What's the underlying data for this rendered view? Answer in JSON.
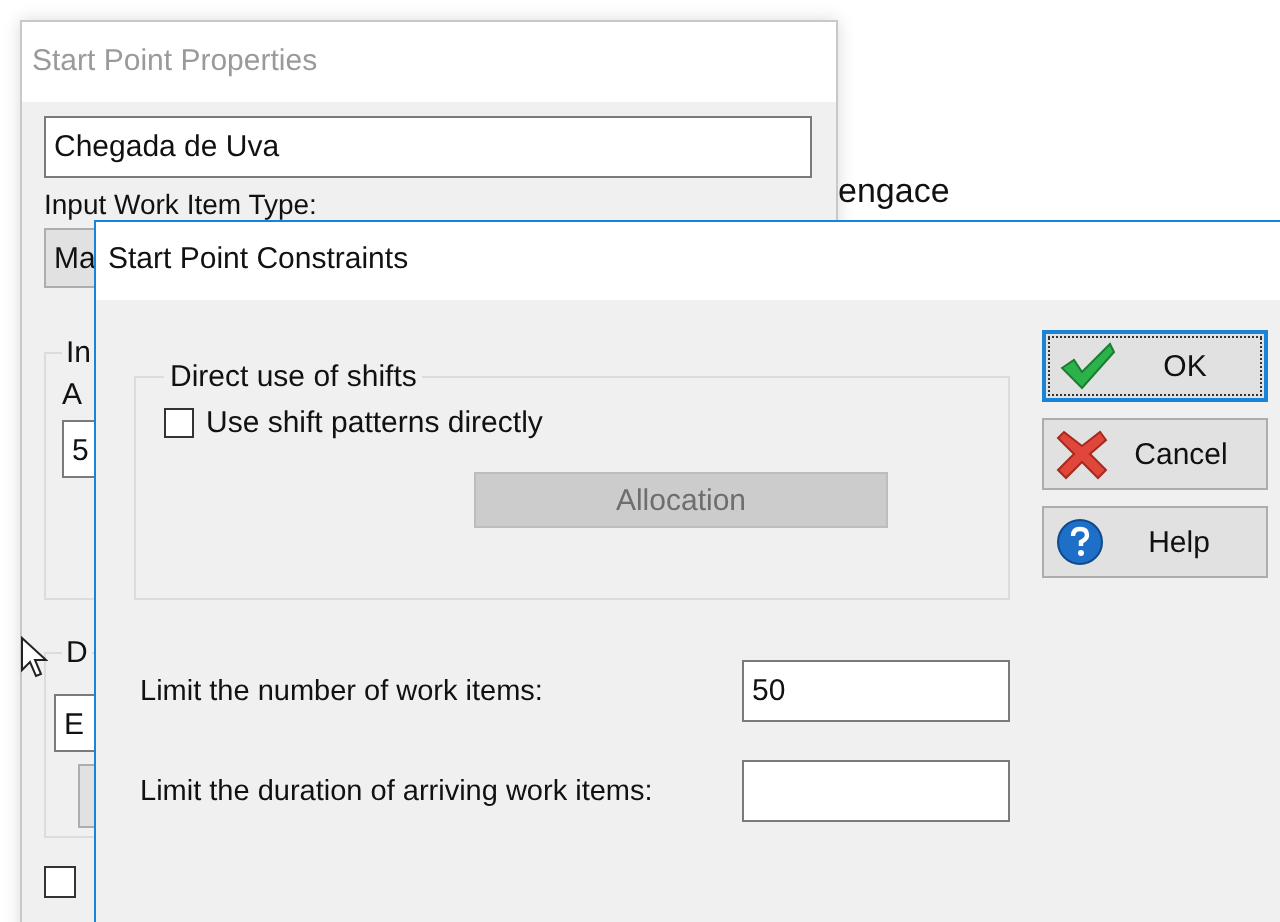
{
  "canvas_text": "engace",
  "back_window": {
    "title": "Start Point Properties",
    "name_field": {
      "value": "Chegada de Uva"
    },
    "type_label": "Input Work Item Type:",
    "type_combo": {
      "value": "Ma"
    },
    "group_1_label": "In",
    "field_1_label": "A",
    "field_1": {
      "value": "5"
    },
    "group_2_label": "D",
    "field_2": {
      "value": "E"
    },
    "checkbox": {
      "checked": false
    }
  },
  "dialog": {
    "title": "Start Point Constraints",
    "group": {
      "label": "Direct use of shifts",
      "checkbox": {
        "label": "Use shift patterns directly",
        "checked": false
      },
      "allocation_button": {
        "label": "Allocation",
        "disabled": true
      }
    },
    "fields": [
      {
        "label": "Limit the number of work items:",
        "value": "50"
      },
      {
        "label": "Limit the duration of arriving work items:"
      }
    ],
    "buttons": [
      {
        "kind": "ok",
        "label": "OK",
        "focused": true
      },
      {
        "kind": "cancel",
        "label": "Cancel",
        "focused": false
      },
      {
        "kind": "help",
        "label": "Help",
        "focused": false
      }
    ]
  }
}
